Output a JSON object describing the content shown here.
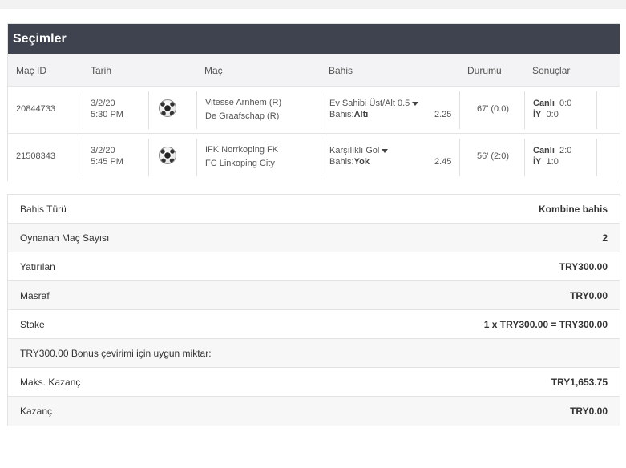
{
  "selections": {
    "title": "Seçimler",
    "columns": {
      "match_id": "Maç ID",
      "date": "Tarih",
      "match": "Maç",
      "bet": "Bahis",
      "status": "Durumu",
      "results": "Sonuçlar"
    },
    "rows": [
      {
        "match_id": "20844733",
        "date": "3/2/20",
        "time": "5:30 PM",
        "icon": "soccer-ball-icon",
        "home": "Vitesse Arnhem (R)",
        "away": "De Graafschap (R)",
        "market": "Ev Sahibi Üst/Alt 0.5",
        "bet_prefix": "Bahis:",
        "bet_pick": "Altı",
        "odds": "2.25",
        "status": "67' (0:0)",
        "live_label": "Canlı",
        "live_score": "0:0",
        "ht_label": "İY",
        "ht_score": "0:0"
      },
      {
        "match_id": "21508343",
        "date": "3/2/20",
        "time": "5:45 PM",
        "icon": "soccer-ball-icon",
        "home": "IFK Norrkoping FK",
        "away": "FC Linkoping City",
        "market": "Karşılıklı Gol",
        "bet_prefix": "Bahis:",
        "bet_pick": "Yok",
        "odds": "2.45",
        "status": "56' (2:0)",
        "live_label": "Canlı",
        "live_score": "2:0",
        "ht_label": "İY",
        "ht_score": "1:0"
      }
    ]
  },
  "summary": {
    "rows": [
      {
        "label": "Bahis Türü",
        "value": "Kombine bahis"
      },
      {
        "label": "Oynanan Maç Sayısı",
        "value": "2"
      },
      {
        "label": "Yatırılan",
        "value": "TRY300.00"
      },
      {
        "label": "Masraf",
        "value": "TRY0.00"
      },
      {
        "label": "Stake",
        "value": "1 x TRY300.00 = TRY300.00"
      },
      {
        "label": "TRY300.00 Bonus çevirimi için uygun miktar:",
        "value": ""
      },
      {
        "label": "Maks. Kazanç",
        "value": "TRY1,653.75"
      },
      {
        "label": "Kazanç",
        "value": "TRY0.00"
      }
    ]
  }
}
